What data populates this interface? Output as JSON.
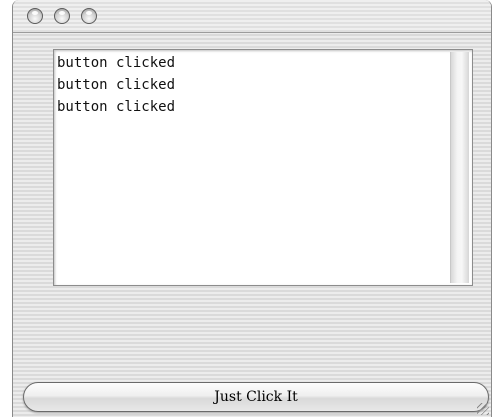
{
  "window": {
    "title": "",
    "buttons": [
      {
        "name": "close",
        "icon": "close-circle-icon"
      },
      {
        "name": "minimize",
        "icon": "minimize-circle-icon"
      },
      {
        "name": "zoom",
        "icon": "zoom-circle-icon"
      }
    ]
  },
  "textarea": {
    "lines": [
      "button clicked",
      "button clicked",
      "button clicked"
    ]
  },
  "button": {
    "label": "Just Click It"
  },
  "colors": {
    "window_background": "#e4e4e4",
    "textarea_background": "#ffffff",
    "text": "#111111"
  }
}
